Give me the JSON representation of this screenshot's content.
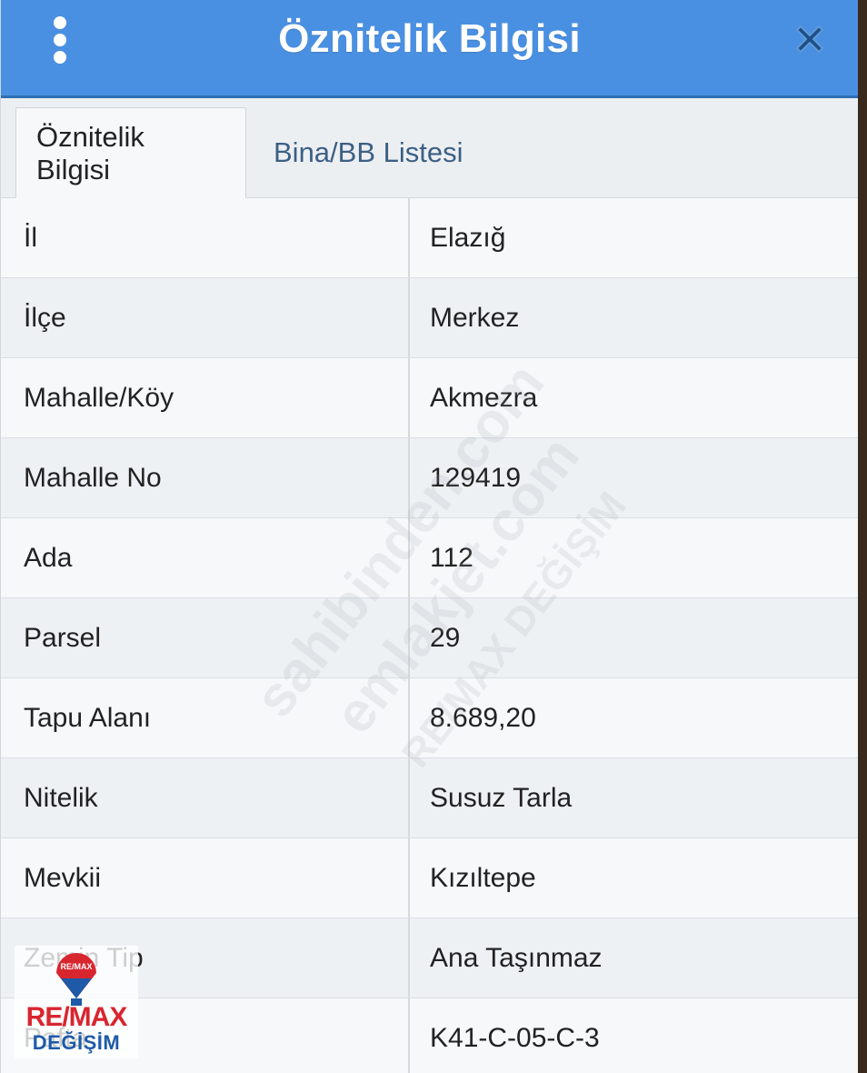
{
  "header": {
    "title": "Öznitelik Bilgisi",
    "menu_icon": "vertical-dots-icon",
    "close_icon": "close-icon"
  },
  "tabs": [
    {
      "label": "Öznitelik Bilgisi",
      "active": true
    },
    {
      "label": "Bina/BB Listesi",
      "active": false
    }
  ],
  "rows": [
    {
      "label": "İl",
      "value": "Elazığ"
    },
    {
      "label": "İlçe",
      "value": "Merkez"
    },
    {
      "label": "Mahalle/Köy",
      "value": "Akmezra"
    },
    {
      "label": "Mahalle No",
      "value": "129419"
    },
    {
      "label": "Ada",
      "value": "112"
    },
    {
      "label": "Parsel",
      "value": "29"
    },
    {
      "label": "Tapu Alanı",
      "value": "8.689,20"
    },
    {
      "label": "Nitelik",
      "value": "Susuz Tarla"
    },
    {
      "label": "Mevkii",
      "value": "Kızıltepe"
    },
    {
      "label": "Zemin Tip",
      "value": "Ana Taşınmaz"
    },
    {
      "label": "Pafta",
      "value": "K41-C-05-C-3"
    }
  ],
  "watermark": {
    "text_line1": "sahibinden.com",
    "text_line2": "emlakjet.com",
    "text_line3": "RE/MAX DEĞİŞİM"
  },
  "logo": {
    "brand": "RE/MAX",
    "subtitle": "DEĞİŞİM",
    "balloon_label": "RE/MAX"
  },
  "colors": {
    "header_bg": "#4a90e2",
    "tab_inactive_text": "#3c5f84",
    "remax_red": "#d8262f",
    "remax_blue": "#1e5aa8"
  }
}
